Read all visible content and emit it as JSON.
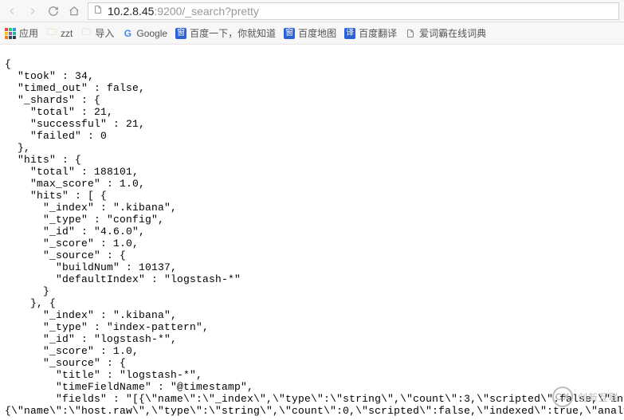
{
  "address": {
    "scheme_host": "10.2.8.45",
    "port_path": ":9200/_search?pretty"
  },
  "bookmarks": {
    "apps": "应用",
    "zzt": "zzt",
    "import": "导入",
    "google": "Google",
    "baidu": "百度一下，你就知道",
    "baidumap": "百度地图",
    "baidutrans": "百度翻译",
    "iciba": "爱词霸在线词典"
  },
  "json_body": "{\n  \"took\" : 34,\n  \"timed_out\" : false,\n  \"_shards\" : {\n    \"total\" : 21,\n    \"successful\" : 21,\n    \"failed\" : 0\n  },\n  \"hits\" : {\n    \"total\" : 188101,\n    \"max_score\" : 1.0,\n    \"hits\" : [ {\n      \"_index\" : \".kibana\",\n      \"_type\" : \"config\",\n      \"_id\" : \"4.6.0\",\n      \"_score\" : 1.0,\n      \"_source\" : {\n        \"buildNum\" : 10137,\n        \"defaultIndex\" : \"logstash-*\"\n      }\n    }, {\n      \"_index\" : \".kibana\",\n      \"_type\" : \"index-pattern\",\n      \"_id\" : \"logstash-*\",\n      \"_score\" : 1.0,\n      \"_source\" : {\n        \"title\" : \"logstash-*\",\n        \"timeFieldName\" : \"@timestamp\",\n        \"fields\" : \"[{\\\"name\\\":\\\"_index\\\",\\\"type\\\":\\\"string\\\",\\\"count\\\":3,\\\"scripted\\\":false,\\\"indexed\\\"\n{\\\"name\\\":\\\"host.raw\\\",\\\"type\\\":\\\"string\\\",\\\"count\\\":0,\\\"scripted\\\":false,\\\"indexed\\\":true,\\\"analyzed\\\"",
  "watermark": "创新互联"
}
